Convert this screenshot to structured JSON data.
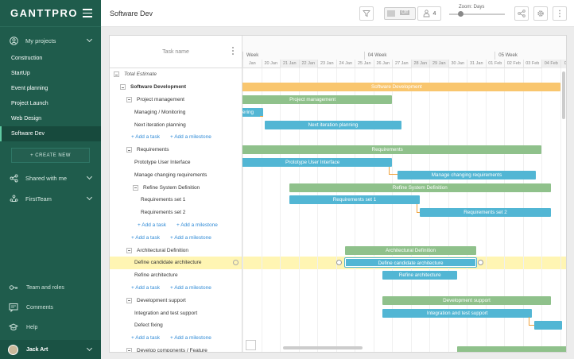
{
  "sidebar": {
    "logo": "GANTTPRO",
    "my_projects": "My projects",
    "projects": [
      "Construction",
      "StartUp",
      "Event planning",
      "Project Launch",
      "Web Design",
      "Software Dev"
    ],
    "active_project": "Software Dev",
    "create_new": "+ CREATE NEW",
    "shared_with_me": "Shared with me",
    "team": "FirstTeam",
    "team_and_roles": "Team and roles",
    "comments": "Comments",
    "help": "Help",
    "user": "Jack Art"
  },
  "topbar": {
    "project_title": "Software Dev",
    "toggle_label": "Off",
    "people_count": "4",
    "zoom_label": "Zoom: Days"
  },
  "gantt": {
    "task_name_header": "Task name",
    "weeks": [
      "Week",
      "04 Week",
      "05 Week"
    ],
    "days": [
      "Jan",
      "20 Jan",
      "21 Jan",
      "22 Jan",
      "23 Jan",
      "24 Jan",
      "25 Jan",
      "26 Jan",
      "27 Jan",
      "28 Jan",
      "29 Jan",
      "30 Jan",
      "31 Jan",
      "01 Feb",
      "02 Feb",
      "03 Feb",
      "04 Feb",
      "05 Fe"
    ],
    "rows": [
      {
        "label": "Total Estimate",
        "type": "italic",
        "indent": 0,
        "toggle": true
      },
      {
        "label": "Software Development",
        "type": "bold",
        "indent": 1,
        "toggle": true
      },
      {
        "label": "Project management",
        "type": "normal",
        "indent": 2,
        "toggle": true
      },
      {
        "label": "Managing / Monitoring",
        "type": "normal",
        "indent": 3
      },
      {
        "label": "Next iteration planning",
        "type": "normal",
        "indent": 3
      },
      {
        "label": "+ Add a task",
        "label2": "+ Add a milestone",
        "type": "link",
        "indent": 3
      },
      {
        "label": "Requirements",
        "type": "normal",
        "indent": 2,
        "toggle": true
      },
      {
        "label": "Prototype User Interface",
        "type": "normal",
        "indent": 3
      },
      {
        "label": "Manage changing requirements",
        "type": "normal",
        "indent": 3
      },
      {
        "label": "Refine System Definition",
        "type": "normal",
        "indent": 3,
        "toggle": true
      },
      {
        "label": "Requirements set 1",
        "type": "normal",
        "indent": 4
      },
      {
        "label": "Requirements set 2",
        "type": "normal",
        "indent": 4
      },
      {
        "label": "+ Add a task",
        "label2": "+ Add a milestone",
        "type": "link",
        "indent": 4
      },
      {
        "label": "+ Add a task",
        "label2": "+ Add a milestone",
        "type": "link",
        "indent": 3
      },
      {
        "label": "Architectural Definition",
        "type": "normal",
        "indent": 2,
        "toggle": true
      },
      {
        "label": "Define candidate architecture",
        "type": "normal",
        "indent": 3,
        "highlight": true
      },
      {
        "label": "Refine architecture",
        "type": "normal",
        "indent": 3
      },
      {
        "label": "+ Add a task",
        "label2": "+ Add a milestone",
        "type": "link",
        "indent": 3
      },
      {
        "label": "Development support",
        "type": "normal",
        "indent": 2,
        "toggle": true
      },
      {
        "label": "Integration and test support",
        "type": "normal",
        "indent": 3
      },
      {
        "label": "Defect fixing",
        "type": "normal",
        "indent": 3
      },
      {
        "label": "+ Add a task",
        "label2": "+ Add a milestone",
        "type": "link",
        "indent": 3
      },
      {
        "label": "Develop components / Feature",
        "type": "normal",
        "indent": 2,
        "toggle": true
      }
    ],
    "bars": [
      {
        "row": 1,
        "label": "Software Development",
        "color": "orange"
      },
      {
        "row": 2,
        "label": "Project management",
        "color": "green"
      },
      {
        "row": 3,
        "label": "ering",
        "color": "blue"
      },
      {
        "row": 4,
        "label": "Next iteration planning",
        "color": "blue"
      },
      {
        "row": 6,
        "label": "Requirements",
        "color": "green"
      },
      {
        "row": 7,
        "label": "Prototype User Interface",
        "color": "blue"
      },
      {
        "row": 8,
        "label": "Manage changing requirements",
        "color": "blue"
      },
      {
        "row": 9,
        "label": "Refine System Definition",
        "color": "green"
      },
      {
        "row": 10,
        "label": "Requirements set 1",
        "color": "blue"
      },
      {
        "row": 11,
        "label": "Requirements set 2",
        "color": "blue"
      },
      {
        "row": 14,
        "label": "Architectural Definition",
        "color": "green"
      },
      {
        "row": 15,
        "label": "Define candidate architecture",
        "color": "blue"
      },
      {
        "row": 16,
        "label": "Refine architecture",
        "color": "blue"
      },
      {
        "row": 18,
        "label": "Development support",
        "color": "green"
      },
      {
        "row": 19,
        "label": "Integration and test support",
        "color": "blue"
      },
      {
        "row": 20,
        "label": "",
        "color": "blue"
      },
      {
        "row": 22,
        "label": "",
        "color": "green"
      }
    ]
  }
}
